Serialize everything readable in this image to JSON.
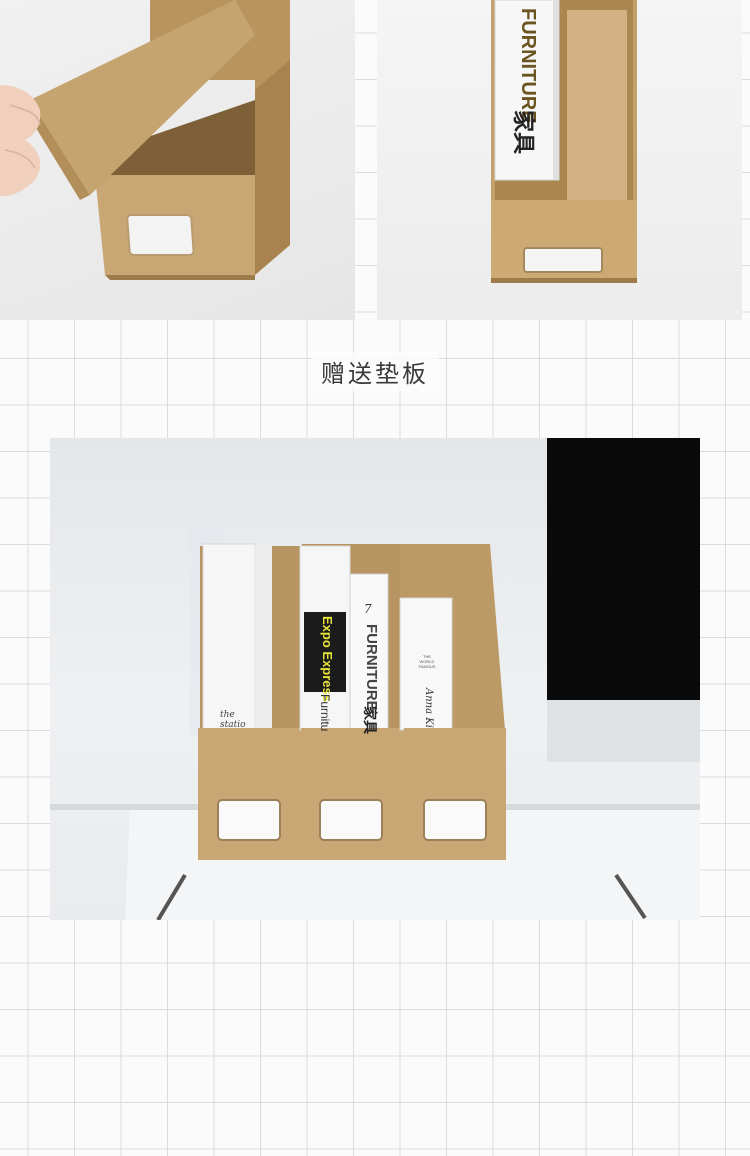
{
  "caption": "赠送垫板",
  "photos": {
    "top_left": {
      "subject": "hand-opening-kraft-file-box"
    },
    "top_right": {
      "book_spine": {
        "title": "FURNITURE",
        "cjk": "家具"
      }
    },
    "main": {
      "books": [
        {
          "spine_lines": [
            "the",
            "statio"
          ]
        },
        {
          "spine_title": "Expo Express",
          "spine_sub": "Furnitu"
        },
        {
          "number": "7",
          "spine_title": "FURNITURE",
          "cjk": "家具"
        },
        {
          "small_lines": [
            "THE",
            "WORLD",
            "FAMOUS"
          ],
          "script": "Anna Ki"
        }
      ]
    }
  },
  "colors": {
    "kraft": "#c9ab7c",
    "kraft_dark": "#a88858",
    "grid_line": "#dcdcdc",
    "monitor": "#0a0a0a",
    "label_band": "#1b1b1b",
    "label_yellow": "#e8e43a"
  }
}
